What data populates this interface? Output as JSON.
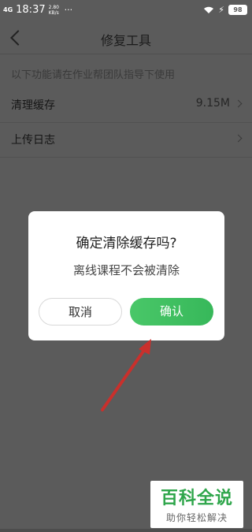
{
  "status_bar": {
    "signal": "4G",
    "time": "18:37",
    "speed": "2.80 KB/s",
    "dots": "···",
    "battery": "98"
  },
  "header": {
    "title": "修复工具"
  },
  "hint": "以下功能请在作业帮团队指导下使用",
  "rows": [
    {
      "label": "清理缓存",
      "value": "9.15M"
    },
    {
      "label": "上传日志",
      "value": ""
    }
  ],
  "dialog": {
    "title": "确定清除缓存吗?",
    "message": "离线课程不会被清除",
    "cancel_label": "取消",
    "confirm_label": "确认"
  },
  "watermark": {
    "main": "百科全说",
    "sub": "助你轻松解决"
  },
  "colors": {
    "accent": "#3fc061",
    "annotation_arrow": "#c9302c"
  }
}
